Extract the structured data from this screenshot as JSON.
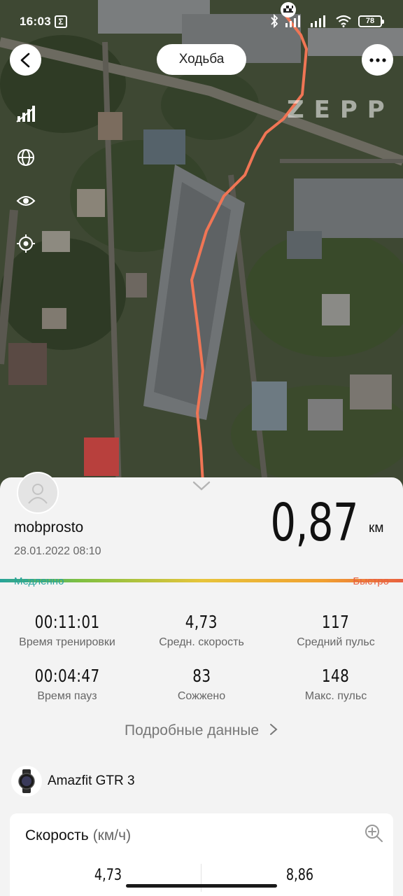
{
  "status_bar": {
    "time": "16:03",
    "notification_glyph": "Σ",
    "battery": "78"
  },
  "map": {
    "activity_type": "Ходьба",
    "watermark": "ZEPP",
    "tools": [
      "signal-strength-icon",
      "globe-icon",
      "eye-icon",
      "locate-icon"
    ],
    "route_color": "#f07555"
  },
  "summary": {
    "username": "mobprosto",
    "datetime": "28.01.2022 08:10",
    "distance_value": "0,87",
    "distance_unit": "км",
    "speed_scale": {
      "slow_label": "Медленно",
      "fast_label": "Быстро",
      "slow_color": "#26a39a",
      "fast_color": "#e8603f"
    }
  },
  "stats": [
    {
      "value": "00:11:01",
      "label": "Время тренировки"
    },
    {
      "value": "4,73",
      "label": "Средн. скорость"
    },
    {
      "value": "117",
      "label": "Средний пульс"
    },
    {
      "value": "00:04:47",
      "label": "Время пауз"
    },
    {
      "value": "83",
      "label": "Сожжено"
    },
    {
      "value": "148",
      "label": "Макс. пульс"
    }
  ],
  "details_link": "Подробные данные",
  "device": {
    "name": "Amazfit GTR 3"
  },
  "speed_card": {
    "title": "Скорость",
    "unit": "(км/ч)",
    "avg": "4,73",
    "max": "8,86"
  }
}
